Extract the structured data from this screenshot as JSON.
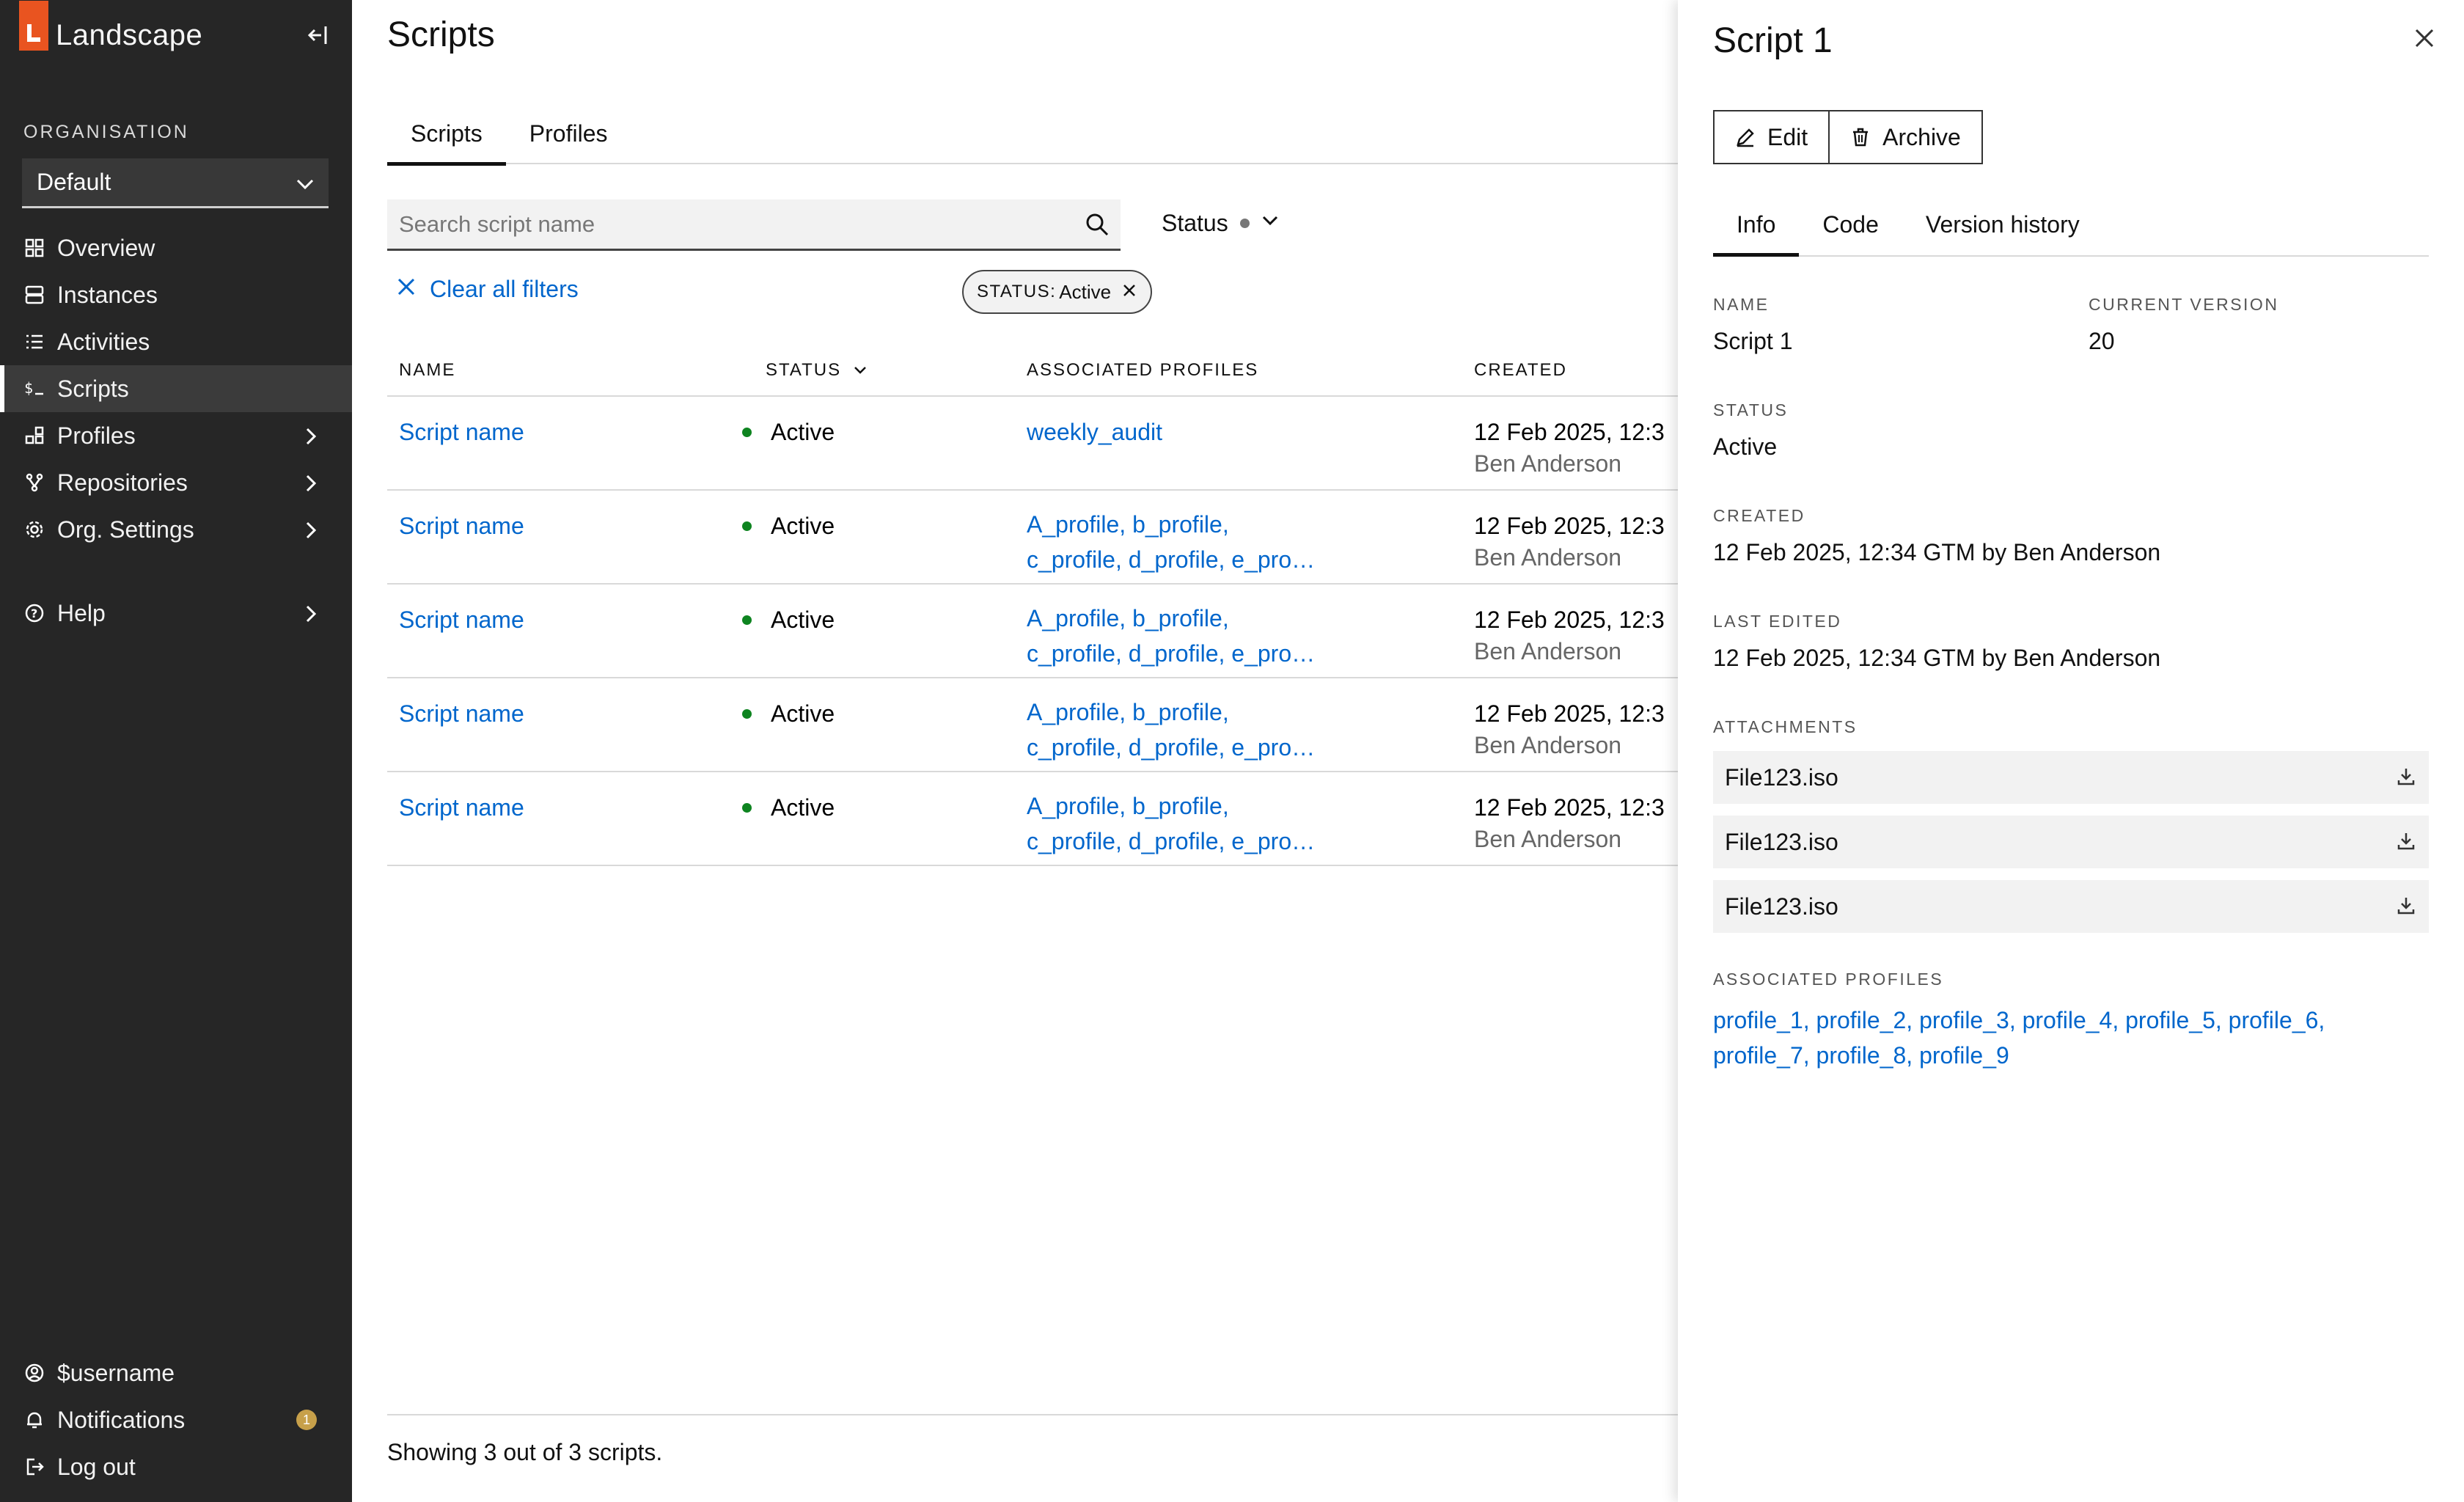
{
  "sidebar": {
    "brand": "Landscape",
    "org_label": "Organisation",
    "org_value": "Default",
    "nav": [
      {
        "label": "Overview",
        "icon": "overview-icon"
      },
      {
        "label": "Instances",
        "icon": "instances-icon"
      },
      {
        "label": "Activities",
        "icon": "activities-icon"
      },
      {
        "label": "Scripts",
        "icon": "scripts-icon",
        "active": true
      },
      {
        "label": "Profiles",
        "icon": "profiles-icon",
        "chevron": true
      },
      {
        "label": "Repositories",
        "icon": "repositories-icon",
        "chevron": true
      },
      {
        "label": "Org. Settings",
        "icon": "settings-gear-icon",
        "chevron": true
      }
    ],
    "help": "Help",
    "bottom": {
      "username": "$username",
      "notifications": "Notifications",
      "notifications_count": "1",
      "logout": "Log out"
    }
  },
  "main": {
    "title": "Scripts",
    "tabs": [
      "Scripts",
      "Profiles"
    ],
    "search_placeholder": "Search script name",
    "status_filter": "Status",
    "clear_filters": "Clear all filters",
    "chip": {
      "key": "STATUS:",
      "value": "Active"
    },
    "columns": [
      "NAME",
      "STATUS",
      "ASSOCIATED PROFILES",
      "CREATED"
    ],
    "rows": [
      {
        "name": "Script name",
        "status": "Active",
        "profiles_1": "weekly_audit",
        "profiles_2": "",
        "created": "12 Feb 2025, 12:3",
        "author": "Ben Anderson"
      },
      {
        "name": "Script name",
        "status": "Active",
        "profiles_1": "A_profile, b_profile,",
        "profiles_2": "c_profile, d_profile, e_pro…",
        "created": "12 Feb 2025, 12:3",
        "author": "Ben Anderson"
      },
      {
        "name": "Script name",
        "status": "Active",
        "profiles_1": "A_profile, b_profile,",
        "profiles_2": "c_profile, d_profile, e_pro…",
        "created": "12 Feb 2025, 12:3",
        "author": "Ben Anderson"
      },
      {
        "name": "Script name",
        "status": "Active",
        "profiles_1": "A_profile, b_profile,",
        "profiles_2": "c_profile, d_profile, e_pro…",
        "created": "12 Feb 2025, 12:3",
        "author": "Ben Anderson"
      },
      {
        "name": "Script name",
        "status": "Active",
        "profiles_1": "A_profile, b_profile,",
        "profiles_2": "c_profile, d_profile, e_pro…",
        "created": "12 Feb 2025, 12:3",
        "author": "Ben Anderson"
      }
    ],
    "footer": "Showing 3 out of 3 scripts."
  },
  "panel": {
    "title": "Script 1",
    "edit": "Edit",
    "archive": "Archive",
    "tabs": [
      "Info",
      "Code",
      "Version history"
    ],
    "name_label": "Name",
    "name_value": "Script 1",
    "version_label": "Current version",
    "version_value": "20",
    "status_label": "Status",
    "status_value": "Active",
    "created_label": "Created",
    "created_value": "12 Feb 2025, 12:34 GTM by Ben Anderson",
    "edited_label": "Last edited",
    "edited_value": "12 Feb 2025, 12:34 GTM by Ben Anderson",
    "attachments_label": "Attachments",
    "attachments": [
      "File123.iso",
      "File123.iso",
      "File123.iso"
    ],
    "profiles_label": "Associated profiles",
    "profiles_line1": "profile_1, profile_2, profile_3, profile_4, profile_5, profile_6,",
    "profiles_line2": "profile_7, profile_8, profile_9"
  },
  "colors": {
    "accent": "#e95420",
    "link": "#0066cc",
    "active_status": "#0e8420",
    "sidebar_bg": "#262626"
  }
}
